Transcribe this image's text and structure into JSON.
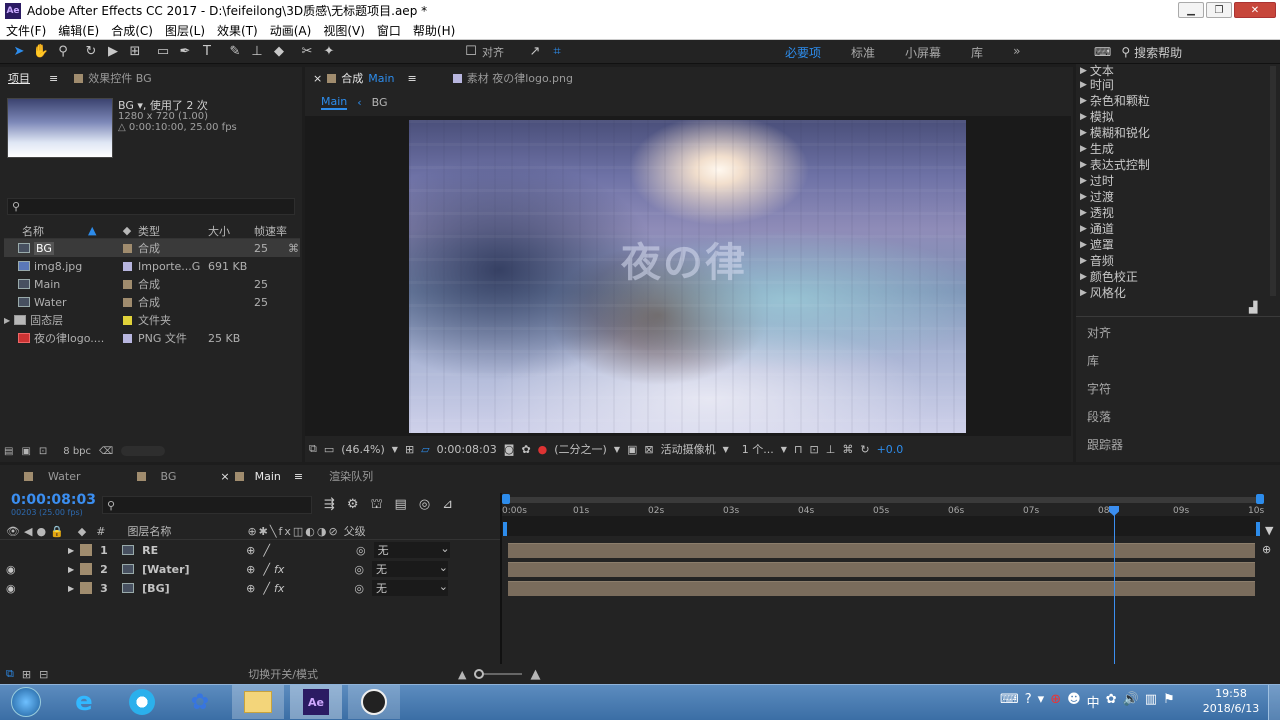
{
  "window": {
    "title": "Adobe After Effects CC 2017 - D:\\feifeilong\\3D质感\\无标题项目.aep *",
    "app_badge": "Ae"
  },
  "menu": [
    "文件(F)",
    "编辑(E)",
    "合成(C)",
    "图层(L)",
    "效果(T)",
    "动画(A)",
    "视图(V)",
    "窗口",
    "帮助(H)"
  ],
  "toolbar": {
    "align_label": "对齐",
    "workspaces": [
      "必要项",
      "标准",
      "小屏幕",
      "库"
    ],
    "active_workspace": "必要项",
    "search_help": "搜索帮助"
  },
  "project": {
    "tab_label": "项目",
    "effects_tab_label": "效果控件 BG",
    "selected": {
      "name": "BG ▾",
      "used": ", 使用了 2 次",
      "dims": "1280 x 720 (1.00)",
      "duration": "△ 0:00:10:00, 25.00 fps"
    },
    "columns": {
      "name": "名称",
      "type": "类型",
      "size": "大小",
      "fps": "帧速率"
    },
    "items": [
      {
        "name": "BG",
        "type": "合成",
        "size": "",
        "fps": "25",
        "color": "#a08c6e",
        "kind": "comp"
      },
      {
        "name": "img8.jpg",
        "type": "Importe...G",
        "size": "691 KB",
        "fps": "",
        "color": "#b8b6df",
        "kind": "image"
      },
      {
        "name": "Main",
        "type": "合成",
        "size": "",
        "fps": "25",
        "color": "#a08c6e",
        "kind": "comp"
      },
      {
        "name": "Water",
        "type": "合成",
        "size": "",
        "fps": "25",
        "color": "#a08c6e",
        "kind": "comp"
      },
      {
        "name": "固态层",
        "type": "文件夹",
        "size": "",
        "fps": "",
        "color": "#e0d23a",
        "kind": "folder"
      },
      {
        "name": "夜の律logo....",
        "type": "PNG 文件",
        "size": "25 KB",
        "fps": "",
        "color": "#b8b6df",
        "kind": "png"
      }
    ],
    "bpc": "8 bpc"
  },
  "comp_panel": {
    "tab_label": "合成",
    "tab_comp": "Main",
    "footage_tab": "素材 夜の律logo.png",
    "breadcrumb": [
      "Main",
      "BG"
    ],
    "logo_text": "夜の律",
    "zoom": "(46.4%)",
    "timecode": "0:00:08:03",
    "resolution": "(二分之一)",
    "camera": "活动摄像机",
    "views": "1 个...",
    "exposure": "+0.0"
  },
  "effects_list": [
    "文本",
    "时间",
    "杂色和颗粒",
    "模拟",
    "模糊和锐化",
    "生成",
    "表达式控制",
    "过时",
    "过渡",
    "透视",
    "通道",
    "遮罩",
    "音频",
    "颜色校正",
    "风格化"
  ],
  "right_panels": [
    "对齐",
    "库",
    "字符",
    "段落",
    "跟踪器"
  ],
  "timeline": {
    "tabs": [
      "Water",
      "BG",
      "Main"
    ],
    "active_tab": "Main",
    "render_queue": "渲染队列",
    "timecode": "0:00:08:03",
    "frame_info": "00203 (25.00 fps)",
    "columns": {
      "num": "#",
      "layer_name": "图层名称",
      "parent": "父级"
    },
    "layers": [
      {
        "num": "1",
        "name": "RE",
        "parent": "无",
        "fx": false,
        "visible": false
      },
      {
        "num": "2",
        "name": "[Water]",
        "parent": "无",
        "fx": true,
        "visible": true
      },
      {
        "num": "3",
        "name": "[BG]",
        "parent": "无",
        "fx": true,
        "visible": true
      }
    ],
    "ruler": [
      "0:00s",
      "01s",
      "02s",
      "03s",
      "04s",
      "05s",
      "06s",
      "07s",
      "08s",
      "09s",
      "10s"
    ],
    "playhead_seconds": 8.12,
    "duration_seconds": 10,
    "footer_label": "切换开关/模式"
  },
  "taskbar": {
    "time": "19:58",
    "date": "2018/6/13",
    "apps": [
      "start-orb",
      "ie",
      "browser",
      "baidu-netdisk",
      "explorer",
      "after-effects",
      "obs"
    ]
  }
}
